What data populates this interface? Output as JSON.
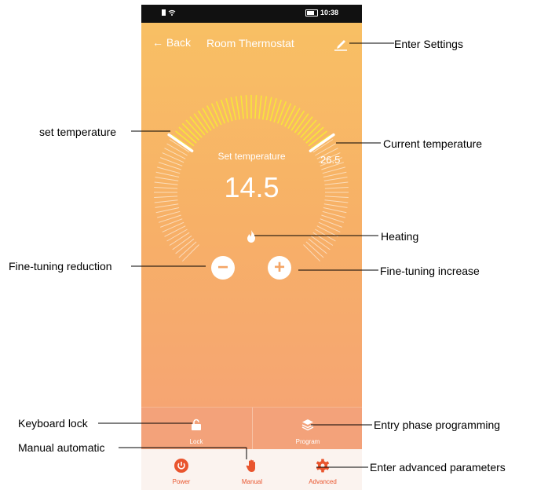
{
  "status_bar": {
    "time": "10:38"
  },
  "header": {
    "back_label": "Back",
    "title": "Room Thermostat"
  },
  "thermostat": {
    "set_label": "Set temperature",
    "set_value": "14.5",
    "current_value": "26.5"
  },
  "tiles": {
    "lock_label": "Lock",
    "program_label": "Program"
  },
  "bottom_nav": {
    "power": "Power",
    "manual": "Manual",
    "advanced": "Advanced"
  },
  "annotations": {
    "enter_settings": "Enter Settings",
    "set_temperature": "set temperature",
    "current_temperature": "Current temperature",
    "heating": "Heating",
    "fine_tuning_reduction": "Fine-tuning reduction",
    "fine_tuning_increase": "Fine-tuning increase",
    "keyboard_lock": "Keyboard lock",
    "entry_phase_programming": "Entry phase programming",
    "manual_automatic": "Manual automatic",
    "enter_advanced_parameters": "Enter advanced parameters"
  },
  "colors": {
    "accent": "#e9552e",
    "dial_active": "#f7e63a",
    "bg_top": "#f8c164",
    "bg_bottom": "#f5a078"
  },
  "icons": [
    "wifi-icon",
    "battery-icon",
    "arrow-left-icon",
    "edit-icon",
    "flame-icon",
    "minus-icon",
    "plus-icon",
    "unlock-icon",
    "layers-icon",
    "power-icon",
    "hand-icon",
    "gear-icon"
  ]
}
